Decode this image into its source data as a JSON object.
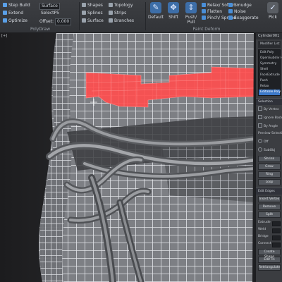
{
  "ribbon": {
    "polydraw": {
      "title": "PolyDraw",
      "step_build": "Step Build",
      "extend": "Extend",
      "optimize": "Optimize",
      "draw_on_label": "Surface",
      "minpx": "SelectP5",
      "offset_label": "Offset:",
      "offset_value": "0.000"
    },
    "freeform": {
      "shapes": "Shapes",
      "splines": "Splines",
      "surface": "Surface",
      "topology": "Topology",
      "strips": "Strips",
      "branches": "Branches"
    },
    "paint": {
      "title": "Paint Deform",
      "default_btn": "Default",
      "shift_btn": "Shift",
      "push_pull_btn": "Push/\nPull",
      "relax_soften": "Relax/ Soften",
      "flatten": "Flatten",
      "pinch_spread": "Pinch/ Spread",
      "smudge": "Smudge",
      "noise": "Noise",
      "exaggerate": "Exaggerate",
      "pick_btn": "Pick"
    }
  },
  "viewport": {
    "label": "[+]"
  },
  "command_panel": {
    "object_name": "Cylinder001",
    "modifier_list": "Modifier List",
    "stack": [
      "Edit Poly",
      "OpenSubdiv HPS",
      "Symmetry",
      "Shell",
      "FaceExtrude",
      "Push",
      "Relax",
      "Editable Poly"
    ],
    "selected_index": 7,
    "rollout_sel": "Selection",
    "by_vertex": "By Vertex",
    "ignore_backfacing": "Ignore Backfacing",
    "by_angle": "By Angle",
    "preview_sel": "Preview Selection",
    "off": "Off",
    "subobj": "SubObj",
    "shrink": "Shrink",
    "grow": "Grow",
    "ring": "Ring",
    "loop": "Loop",
    "rollout_edit": "Edit Edges",
    "insert_vertex": "Insert Vertex",
    "remove": "Remove",
    "split": "Split",
    "extrude": "Extrude",
    "weld": "Weld",
    "bridge": "Bridge",
    "connect": "Connect",
    "create_shape": "Create Shape",
    "edit_tri": "Edit Tri",
    "retriangulate": "Retriangulate"
  },
  "colors": {
    "selection": "#ff4d4d",
    "accent": "#3c78c8",
    "mesh_wire": "#d9dbe0"
  }
}
